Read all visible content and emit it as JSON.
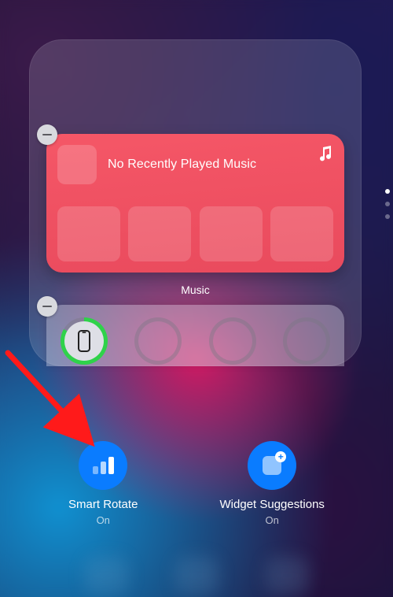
{
  "widgets": {
    "music": {
      "title": "No Recently Played Music",
      "caption": "Music",
      "icon": "music-note-icon"
    },
    "batteries": {
      "device_icon": "iphone-icon"
    }
  },
  "options": {
    "smart_rotate": {
      "title": "Smart Rotate",
      "status": "On"
    },
    "widget_suggestions": {
      "title": "Widget Suggestions",
      "status": "On"
    }
  },
  "pagination": {
    "count": 3,
    "active": 0
  }
}
